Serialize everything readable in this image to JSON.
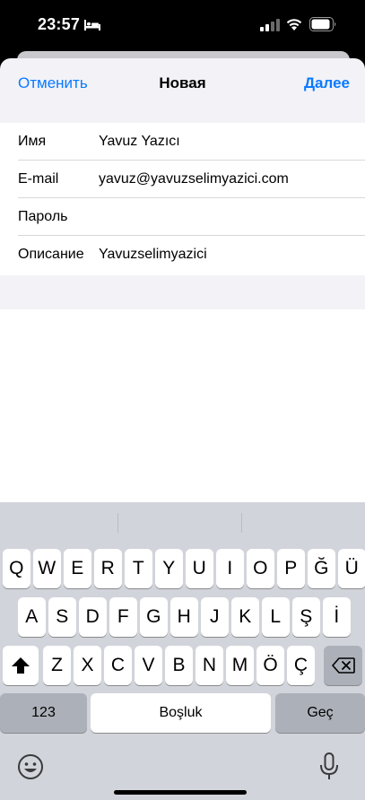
{
  "status_bar": {
    "time": "23:57",
    "icons": [
      "bed-icon",
      "cellular-signal-icon",
      "wifi-icon",
      "battery-icon"
    ]
  },
  "nav": {
    "cancel_label": "Отменить",
    "title": "Новая",
    "next_label": "Далее"
  },
  "form": {
    "fields": [
      {
        "label": "Имя",
        "value": "Yavuz Yazıcı"
      },
      {
        "label": "E-mail",
        "value": "yavuz@yavuzselimyazici.com"
      },
      {
        "label": "Пароль",
        "value": ""
      },
      {
        "label": "Описание",
        "value": "Yavuzselimyazici"
      }
    ]
  },
  "keyboard": {
    "row1": [
      "Q",
      "W",
      "E",
      "R",
      "T",
      "Y",
      "U",
      "I",
      "O",
      "P",
      "Ğ",
      "Ü"
    ],
    "row2": [
      "A",
      "S",
      "D",
      "F",
      "G",
      "H",
      "J",
      "K",
      "L",
      "Ş",
      "İ"
    ],
    "row3": [
      "Z",
      "X",
      "C",
      "V",
      "B",
      "N",
      "M",
      "Ö",
      "Ç"
    ],
    "numbers_label": "123",
    "space_label": "Boşluk",
    "go_label": "Geç",
    "icons": [
      "shift-icon",
      "delete-icon",
      "emoji-icon",
      "microphone-icon"
    ]
  },
  "colors": {
    "accent": "#0a7aff",
    "background": "#f2f2f7",
    "keyboard_bg": "#d1d4da",
    "key_bg": "#ffffff",
    "function_key_bg": "#acb1b9"
  }
}
